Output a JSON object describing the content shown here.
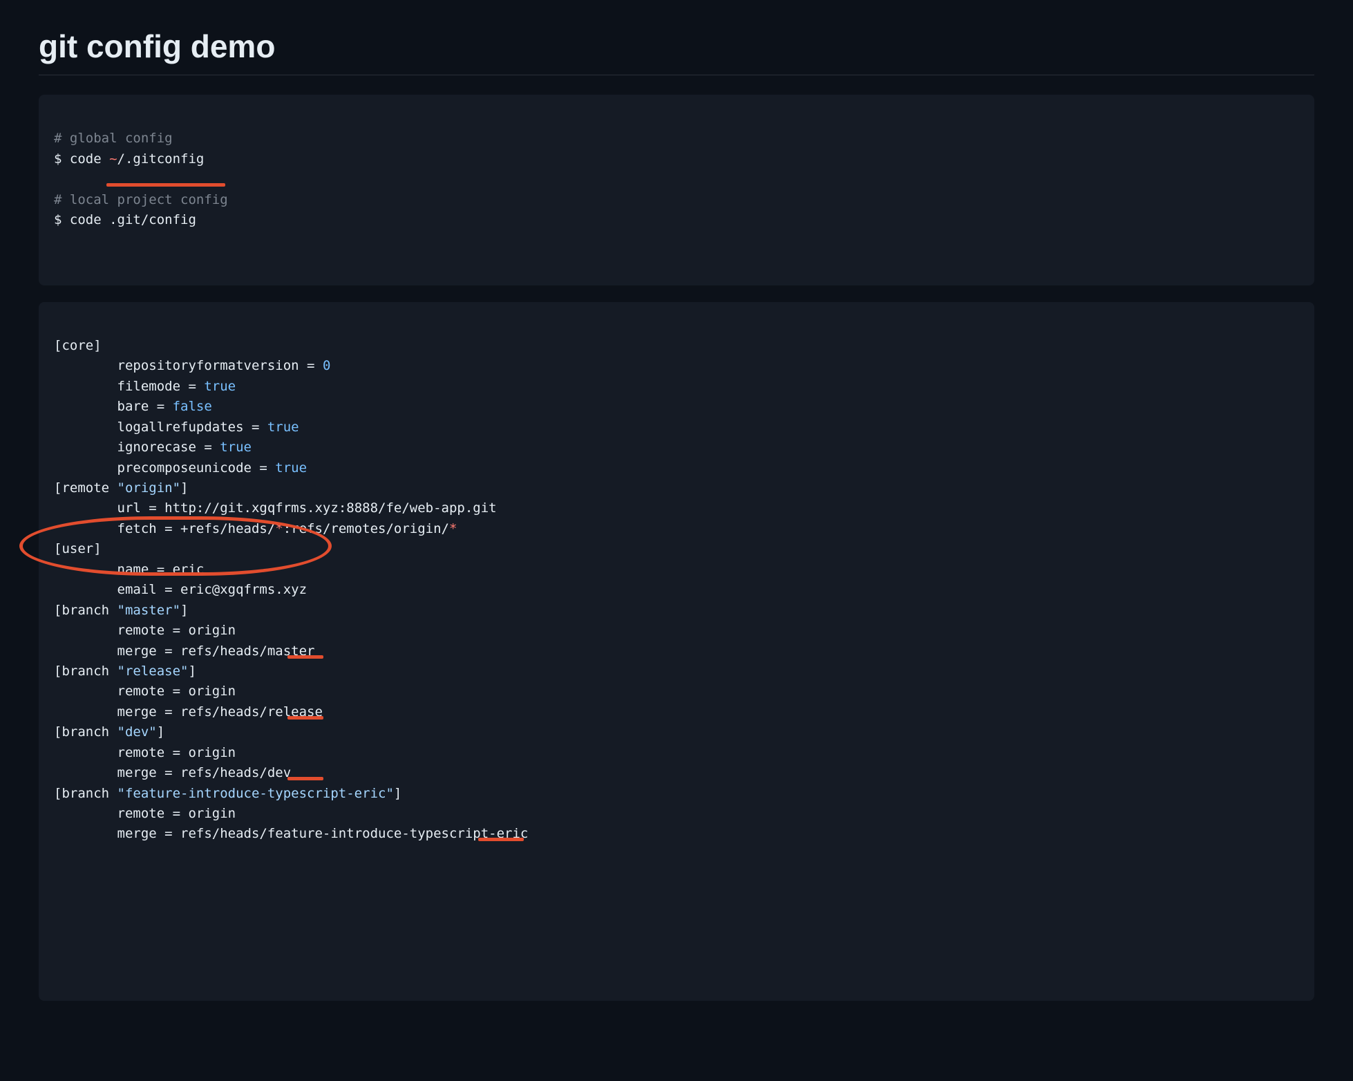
{
  "title": "git config demo",
  "block1": {
    "comment_global": "# global config",
    "cmd_global_prefix": "$ code ",
    "cmd_global_tilde": "~",
    "cmd_global_path": "/.gitconfig",
    "comment_local": "# local project config",
    "cmd_local_prefix": "$ code ",
    "cmd_local_path": ".git/config"
  },
  "block2": {
    "core_header": "[core]",
    "core_repoformat_key": "repositoryformatversion = ",
    "core_repoformat_val": "0",
    "core_filemode_key": "filemode = ",
    "core_filemode_val": "true",
    "core_bare_key": "bare = ",
    "core_bare_val": "false",
    "core_logallref_key": "logallrefupdates = ",
    "core_logallref_val": "true",
    "core_ignorecase_key": "ignorecase = ",
    "core_ignorecase_val": "true",
    "core_precompose_key": "precomposeunicode = ",
    "core_precompose_val": "true",
    "remote_header_pre": "[remote ",
    "remote_header_name": "\"origin\"",
    "remote_header_post": "]",
    "remote_url_key": "url = ",
    "remote_url_val": "http://git.xgqfrms.xyz:8888/fe/web-app.git",
    "remote_fetch_key": "fetch = ",
    "remote_fetch_pre": "+refs/heads/",
    "remote_fetch_star1": "*",
    "remote_fetch_mid": ":refs/remotes/origin/",
    "remote_fetch_star2": "*",
    "user_header": "[user]",
    "user_name_key": "name = ",
    "user_name_val": "eric",
    "user_email_key": "email = ",
    "user_email_val": "eric@xgqfrms.xyz",
    "br_master_pre": "[branch ",
    "br_master_name": "\"master\"",
    "br_master_post": "]",
    "br_master_remote": "remote = origin",
    "br_master_merge_key": "merge = ",
    "br_master_merge_val": "refs/heads/master",
    "br_release_pre": "[branch ",
    "br_release_name": "\"release\"",
    "br_release_post": "]",
    "br_release_remote": "remote = origin",
    "br_release_merge_key": "merge = ",
    "br_release_merge_val": "refs/heads/release",
    "br_dev_pre": "[branch ",
    "br_dev_name": "\"dev\"",
    "br_dev_post": "]",
    "br_dev_remote": "remote = origin",
    "br_dev_merge_key": "merge = ",
    "br_dev_merge_val": "refs/heads/dev",
    "br_feat_pre": "[branch ",
    "br_feat_name": "\"feature-introduce-typescript-eric\"",
    "br_feat_post": "]",
    "br_feat_remote": "remote = origin",
    "br_feat_merge_key": "merge = ",
    "br_feat_merge_val": "refs/heads/feature-introduce-typescript-eric"
  },
  "annotations": {
    "underline_local_cmd": "code .git/config underline",
    "circle_user_section": "user section circle",
    "underline_master": "master underline",
    "underline_release": "release underline",
    "underline_dev": "dev underline",
    "underline_feat_eric": "eric underline"
  }
}
